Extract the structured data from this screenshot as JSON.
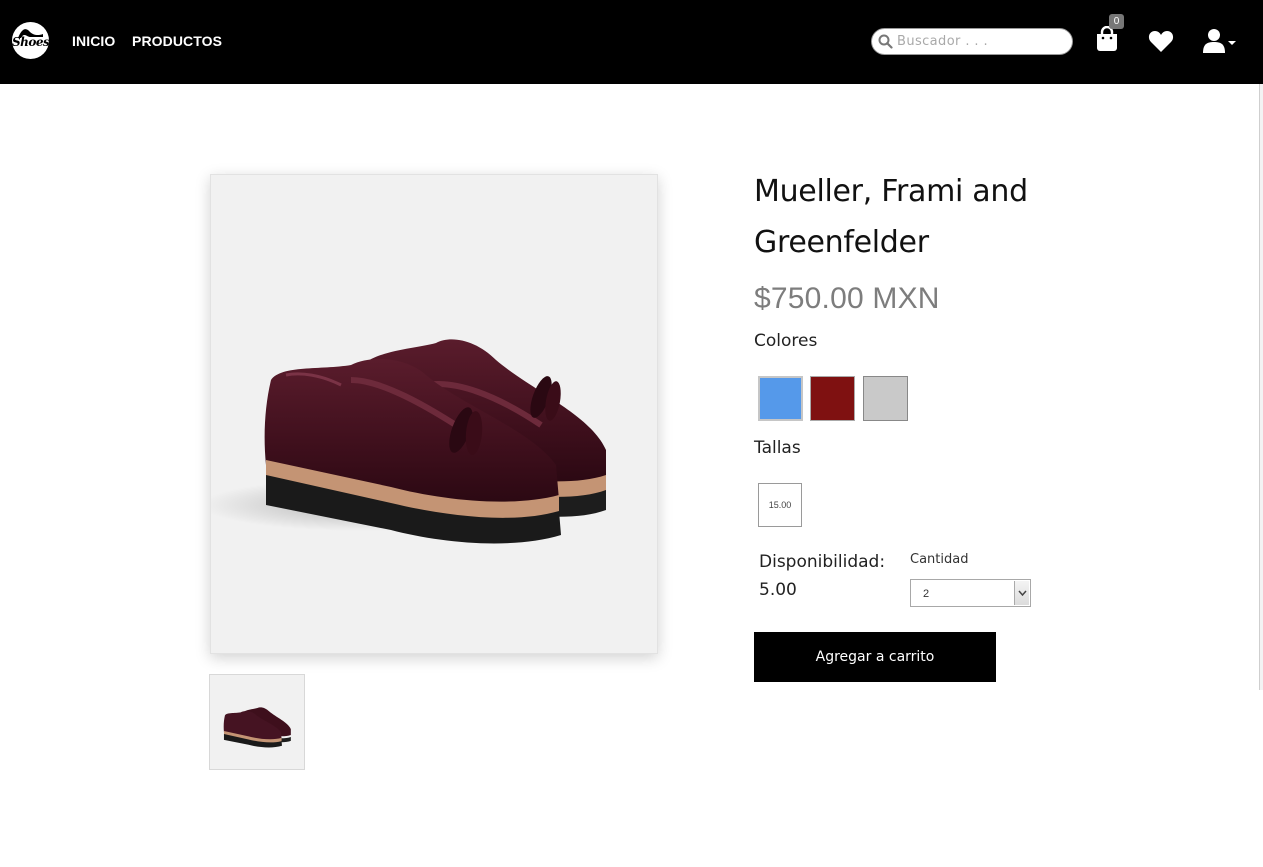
{
  "header": {
    "logo_text": "Shoes",
    "nav": [
      {
        "label": "INICIO"
      },
      {
        "label": "PRODUCTOS"
      }
    ],
    "search": {
      "placeholder": "Buscador . . ."
    },
    "cart": {
      "icon": "shopping-bag-icon",
      "count": "0"
    },
    "favorites": {
      "icon": "heart-icon"
    },
    "account": {
      "icon": "user-icon"
    }
  },
  "product": {
    "name": "Mueller, Frami and Greenfelder",
    "price": "$750.00 MXN",
    "colors_label": "Colores",
    "colors": [
      {
        "name": "blue",
        "hex": "#5599ea"
      },
      {
        "name": "red",
        "hex": "#7f1111"
      },
      {
        "name": "gray",
        "hex": "#c9c9c9"
      }
    ],
    "sizes_label": "Tallas",
    "sizes": [
      "15.00"
    ],
    "availability_label": "Disponibilidad:",
    "availability_value": "5.00",
    "quantity_label": "Cantidad",
    "quantity_value": "2",
    "add_to_cart_label": "Agregar a carrito"
  }
}
